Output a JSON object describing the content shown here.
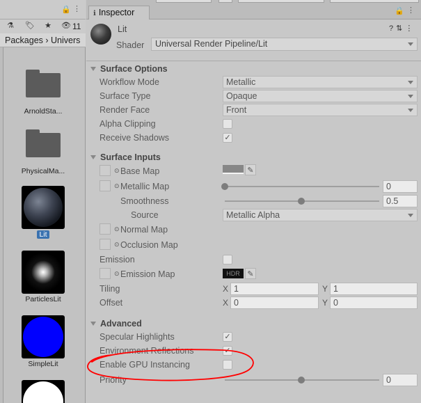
{
  "project": {
    "tool_count": "11",
    "breadcrumb": "Packages › Univers",
    "assets": [
      {
        "label": "ArnoldSta..."
      },
      {
        "label": "PhysicalMa..."
      },
      {
        "label": "Lit"
      },
      {
        "label": "ParticlesLit"
      },
      {
        "label": "SimpleLit"
      }
    ]
  },
  "inspector": {
    "tab_label": "Inspector",
    "material_name": "Lit",
    "shader_label": "Shader",
    "shader_value": "Universal Render Pipeline/Lit",
    "surface_options": {
      "title": "Surface Options",
      "workflow_label": "Workflow Mode",
      "workflow_value": "Metallic",
      "surface_type_label": "Surface Type",
      "surface_type_value": "Opaque",
      "render_face_label": "Render Face",
      "render_face_value": "Front",
      "alpha_clipping_label": "Alpha Clipping",
      "receive_shadows_label": "Receive Shadows"
    },
    "surface_inputs": {
      "title": "Surface Inputs",
      "base_map_label": "Base Map",
      "metallic_map_label": "Metallic Map",
      "metallic_value": "0",
      "smoothness_label": "Smoothness",
      "smoothness_value": "0.5",
      "source_label": "Source",
      "source_value": "Metallic Alpha",
      "normal_map_label": "Normal Map",
      "occlusion_map_label": "Occlusion Map",
      "emission_label": "Emission",
      "emission_map_label": "Emission Map",
      "hdr_label": "HDR",
      "tiling_label": "Tiling",
      "tiling_x": "1",
      "tiling_y": "1",
      "offset_label": "Offset",
      "offset_x": "0",
      "offset_y": "0",
      "x_label": "X",
      "y_label": "Y"
    },
    "advanced": {
      "title": "Advanced",
      "specular_label": "Specular Highlights",
      "env_reflections_label": "Environment Reflections",
      "gpu_instancing_label": "Enable GPU Instancing",
      "priority_label": "Priority",
      "priority_value": "0"
    }
  },
  "colors": {
    "annotation": "#ff0000",
    "selection": "#3a72b0"
  }
}
